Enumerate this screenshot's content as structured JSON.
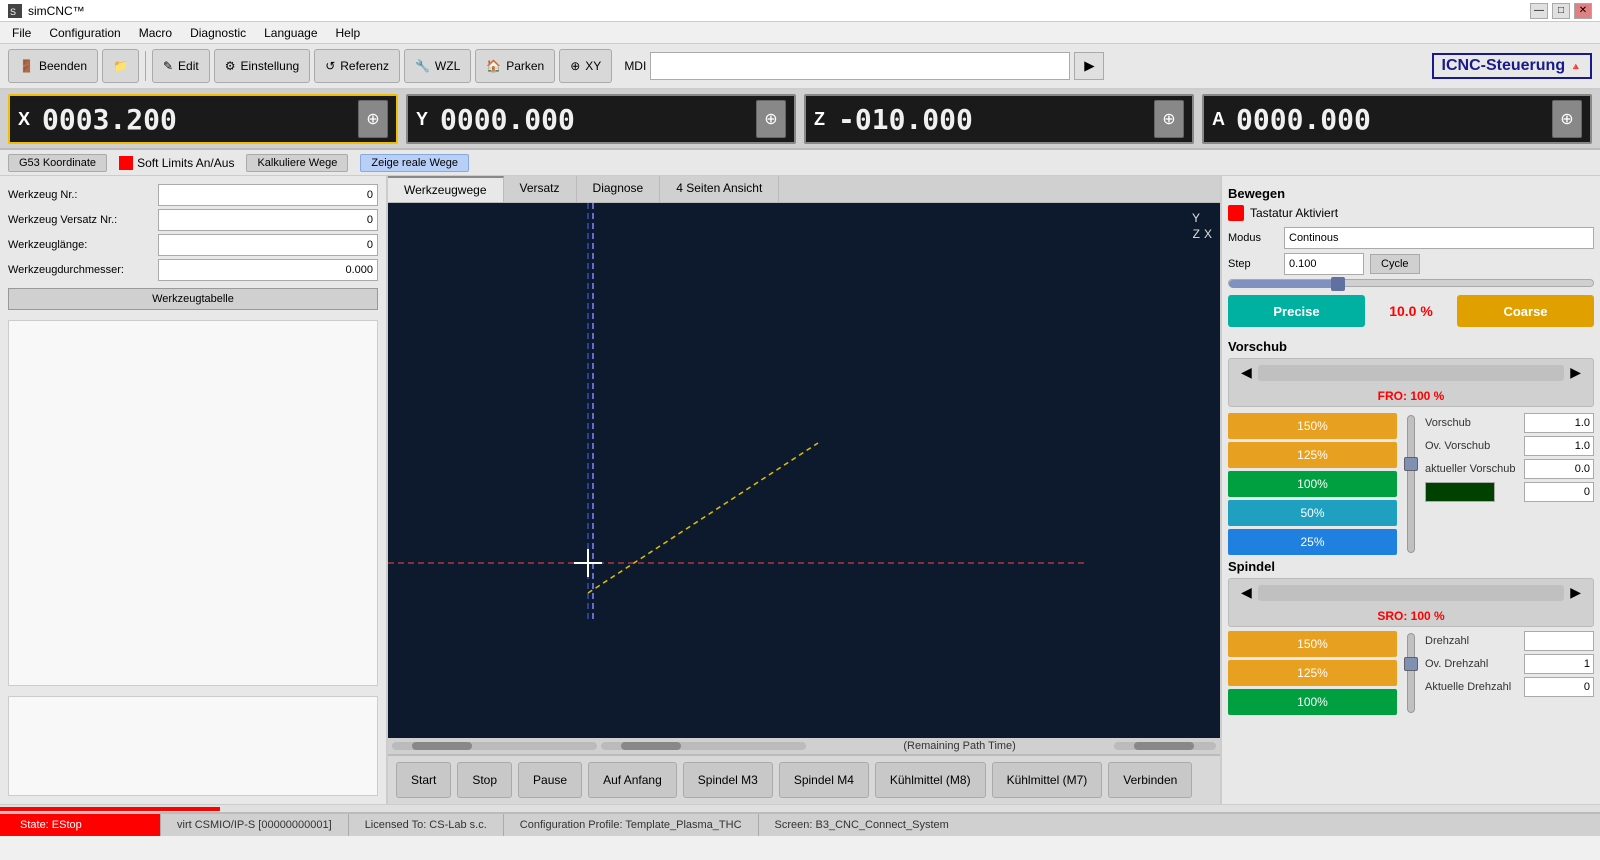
{
  "titlebar": {
    "title": "simCNC™",
    "minimize": "—",
    "maximize": "□",
    "close": "✕"
  },
  "menubar": {
    "items": [
      "File",
      "Configuration",
      "Macro",
      "Diagnostic",
      "Language",
      "Help"
    ]
  },
  "toolbar": {
    "beenden_label": "Beenden",
    "edit_label": "Edit",
    "einstellung_label": "Einstellung",
    "referenz_label": "Referenz",
    "wzl_label": "WZL",
    "parken_label": "Parken",
    "xy_label": "XY",
    "mdi_label": "MDI",
    "mdi_placeholder": "",
    "logo_text": "ICNC-Steuerung"
  },
  "axes": {
    "x": {
      "label": "X",
      "value": "0003.200",
      "active": true
    },
    "y": {
      "label": "Y",
      "value": "0000.000",
      "active": false
    },
    "z": {
      "label": "Z",
      "value": "-010.000",
      "active": false
    },
    "a": {
      "label": "A",
      "value": "0000.000",
      "active": false
    }
  },
  "coord_bar": {
    "g53_label": "G53 Koordinate",
    "soft_limits_label": "Soft Limits An/Aus",
    "kalkuliere_label": "Kalkuliere Wege",
    "zeige_label": "Zeige reale Wege"
  },
  "left_panel": {
    "werkzeug_nr_label": "Werkzeug Nr.:",
    "werkzeug_nr_value": "0",
    "versatz_nr_label": "Werkzeug Versatz Nr.:",
    "versatz_nr_value": "0",
    "laenge_label": "Werkzeuglänge:",
    "laenge_value": "0",
    "durchmesser_label": "Werkzeugdurchmesser:",
    "durchmesser_value": "0.000",
    "tabelle_label": "Werkzeugtabelle"
  },
  "tabs": {
    "items": [
      "Werkzeugwege",
      "Versatz",
      "Diagnose",
      "4 Seiten Ansicht"
    ],
    "active": 0
  },
  "viewport": {
    "axis_y": "Y",
    "axis_z": "Z",
    "axis_x": "X",
    "remaining_path": "(Remaining Path Time)"
  },
  "control_buttons": {
    "start": "Start",
    "stop": "Stop",
    "pause": "Pause",
    "auf_anfang": "Auf Anfang",
    "spindel_m3": "Spindel M3",
    "spindel_m4": "Spindel M4",
    "kuehlmittel_m8": "Kühlmittel (M8)",
    "kuehlmittel_m7": "Kühlmittel (M7)",
    "verbinden": "Verbinden"
  },
  "bewegen": {
    "title": "Bewegen",
    "tastatur_label": "Tastatur Aktiviert",
    "modus_label": "Modus",
    "modus_value": "Continous",
    "step_label": "Step",
    "step_value": "0.100",
    "cycle_label": "Cycle",
    "precise_label": "Precise",
    "pct_value": "10.0 %",
    "coarse_label": "Coarse"
  },
  "vorschub": {
    "title": "Vorschub",
    "fro_label": "FRO: 100 %",
    "btn_150": "150%",
    "btn_125": "125%",
    "btn_100": "100%",
    "btn_50": "50%",
    "btn_25": "25%",
    "vorschub_label": "Vorschub",
    "vorschub_value": "1.0",
    "ov_vorschub_label": "Ov. Vorschub",
    "ov_vorschub_value": "1.0",
    "aktueller_label": "aktueller Vorschub",
    "aktueller_value": "0.0",
    "zero_value": "0"
  },
  "spindel": {
    "title": "Spindel",
    "sro_label": "SRO: 100 %",
    "btn_150": "150%",
    "btn_125": "125%",
    "btn_100": "100%",
    "drehzahl_label": "Drehzahl",
    "drehzahl_value": "",
    "ov_drehzahl_label": "Ov. Drehzahl",
    "ov_drehzahl_value": "1",
    "aktuelle_label": "Aktuelle Drehzahl",
    "aktuelle_value": "0"
  },
  "statusbar": {
    "estop": "State: EStop",
    "virt": "virt CSMIO/IP-S [00000000001]",
    "licensed": "Licensed To: CS-Lab s.c.",
    "profile": "Configuration Profile: Template_Plasma_THC",
    "screen": "Screen: B3_CNC_Connect_System"
  }
}
